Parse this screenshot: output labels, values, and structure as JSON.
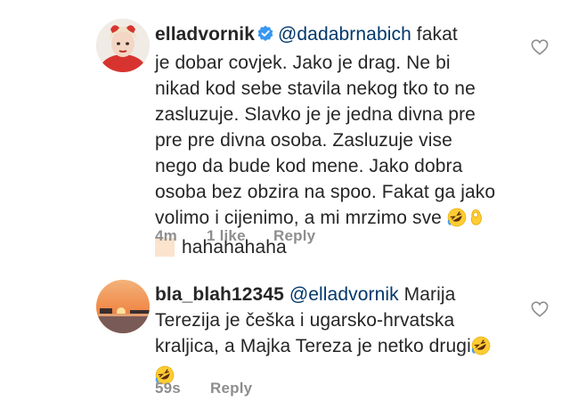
{
  "comments": [
    {
      "username": "elladvornik",
      "verified": true,
      "mention": "@dadabrnabich",
      "line_first": " fakat",
      "lines": [
        "je dobar covjek. Jako je drag. Ne bi",
        "nikad kod sebe stavila nekog tko to ne",
        "zasluzuje. Slavko je je jedna divna pre",
        "pre pre divna osoba. Zasluzuje vise",
        "nego da bude kod mene. Jako dobra",
        "osoba bez obzira na spoo. Fakat ga jako",
        "volimo i cijenimo, a mi mrzimo sve"
      ],
      "last_line": "hahahahaha",
      "time": "4m",
      "likes": "1 like",
      "reply": "Reply",
      "avatar_icon": "user-avatar-red-icon",
      "colors": {
        "avatar_bg": "#d8342f"
      }
    },
    {
      "username": "bla_blah12345",
      "mention": "@elladvornik",
      "line_first": " Marija",
      "lines": [
        "Terezija je češka i ugarsko-hrvatska",
        "kraljica, a Majka Tereza je netko drugi"
      ],
      "time": "59s",
      "reply": "Reply",
      "avatar_icon": "sunset-avatar-icon"
    }
  ],
  "colors": {
    "text": "#262626",
    "mention": "#00376b",
    "meta": "#8e8e8e",
    "verified": "#3897f0"
  }
}
